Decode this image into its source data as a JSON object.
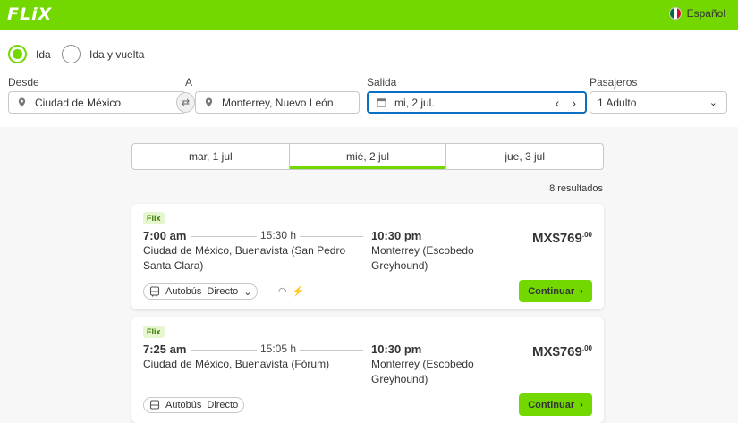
{
  "header": {
    "logo": "FLiX",
    "language": "Español"
  },
  "search": {
    "trip_type": {
      "one_way": "Ida",
      "round_trip": "Ida y vuelta",
      "selected": "one_way"
    },
    "from": {
      "label": "Desde",
      "value": "Ciudad de México"
    },
    "to": {
      "label": "A",
      "value": "Monterrey, Nuevo León"
    },
    "date": {
      "label": "Salida",
      "value": "mi, 2 jul."
    },
    "passengers": {
      "label": "Pasajeros",
      "value": "1 Adulto"
    }
  },
  "day_tabs": [
    {
      "label": "mar, 1 jul",
      "active": false
    },
    {
      "label": "mié, 2 jul",
      "active": true
    },
    {
      "label": "jue, 3 jul",
      "active": false
    }
  ],
  "results_count": "8 resultados",
  "trips": [
    {
      "brand": "Flix",
      "departure_time": "7:00 am",
      "duration": "15:30 h",
      "arrival_time": "10:30 pm",
      "departure_station": "Ciudad de México, Buenavista (San Pedro Santa Clara)",
      "arrival_station": "Monterrey (Escobedo Greyhound)",
      "price_main": "MX$769",
      "price_cents": ".00",
      "vehicle": "Autobús",
      "route_type": "Directo",
      "button": "Continuar"
    },
    {
      "brand": "Flix",
      "departure_time": "7:25 am",
      "duration": "15:05 h",
      "arrival_time": "10:30 pm",
      "departure_station": "Ciudad de México, Buenavista (Fórum)",
      "arrival_station": "Monterrey (Escobedo Greyhound)",
      "price_main": "MX$769",
      "price_cents": ".00",
      "vehicle": "Autobús",
      "route_type": "Directo",
      "button": "Continuar"
    }
  ],
  "colors": {
    "brand_green": "#73d700",
    "focus_blue": "#0b6fc2",
    "text": "#353535"
  }
}
